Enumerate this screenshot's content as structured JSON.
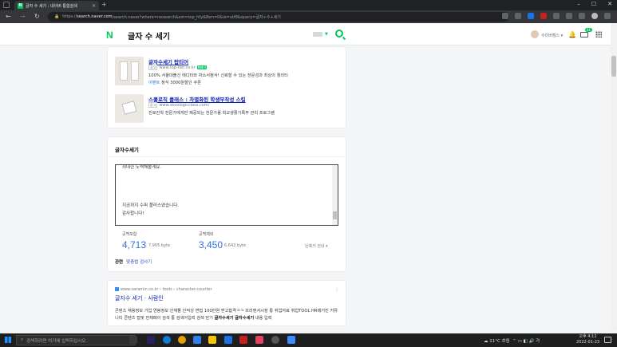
{
  "browser": {
    "tab_title": "글자 수 세기 : 네이버 통합검색",
    "url_prefix": "https://",
    "url_host": "search.naver.com",
    "url_path": "/search.naver?where=nexearch&sm=top_hty&fbm=0&ie=utf8&query=글자+수+세기"
  },
  "naver": {
    "logo": "N",
    "query": "글자 수 세기",
    "user_name": "수미버캠스 ▾",
    "mail_count": "41"
  },
  "ads": [
    {
      "title": "글자수세기 탑티어",
      "ad_tag": "광고",
      "url": "www.top-tier.co.kr",
      "badge": "N페이",
      "desc": "100% 서울대출신 에디터와 자소서첨삭! 신뢰할 수 있는 전문성과 최상의 퀄리티",
      "extra_link": "이벤트",
      "extra_text": "정식 3000원할인 쿠폰"
    },
    {
      "title": "스쿨로직 클래스 : 차별화된 학생부작성 스킬",
      "ad_tag": "광고",
      "url": "www.skoologicclass.com/",
      "desc": "진로진학 전문가에게만 제공되는 전문가용 학교생활기록부 관리 프로그램"
    }
  ],
  "counter": {
    "title": "글자수세기",
    "text_lines": [
      "최대한 노력해볼게요.",
      "지금까지 수퍼 플러스였습니다.",
      "감사합니다!"
    ],
    "with_space_label": "공백포함",
    "with_space_count": "4,713",
    "with_space_bytes": "7,905 byte",
    "without_space_label": "공백제외",
    "without_space_count": "3,450",
    "without_space_bytes": "6,642 byte",
    "shortcut": "단축키 안내 ▾",
    "related_label": "관련",
    "related_link": "맞춤법 검사기"
  },
  "result": {
    "site": "www.saramin.co.kr › tools › character-counter",
    "title_main": "글자수 세기",
    "title_sep": " - ",
    "title_sub": "사람인",
    "desc_pre": "콘텐츠 채용정보 기업 연봉정보 인재풀 인적성 면접 100만원 받고합격ㅋㅋ 프리랜서시장 통 취업자료 취업TOOL HR매거진 커뮤니티 콘텐츠 접및 전제페이 검색 통 검색어입력 검색 닫기 ",
    "desc_bold": "글자수세기 글자수세기",
    "desc_post": " 내용 입력"
  },
  "taskbar": {
    "search_placeholder": "검색하려면 여기에 입력하십시오.",
    "weather": "11°C 흐림",
    "tray_lang": "가",
    "time": "오후 4:12",
    "date": "2022-01-23"
  }
}
